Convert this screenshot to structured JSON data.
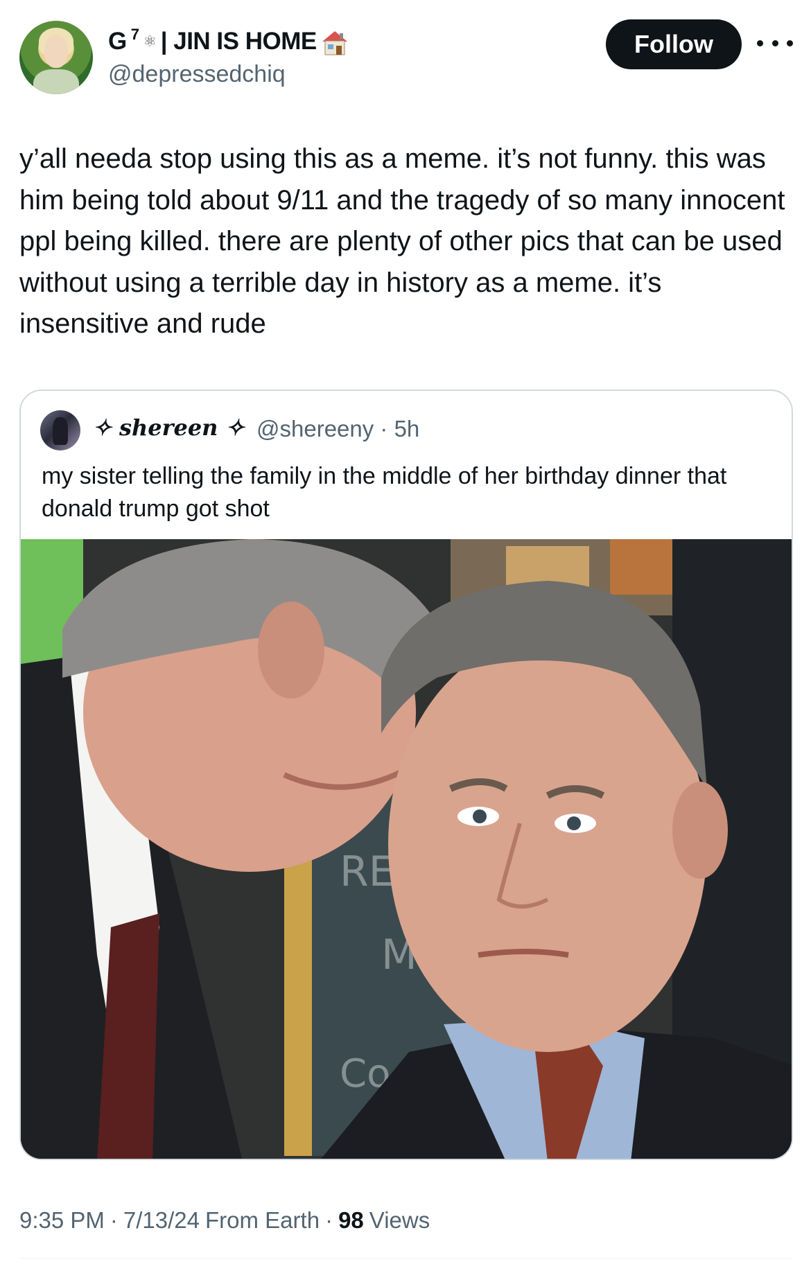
{
  "author": {
    "display_name": "G",
    "superscript": "7",
    "name_suffix": "| JIN IS HOME",
    "emoji_icon": "house-icon",
    "handle": "@depressedchiq"
  },
  "actions": {
    "follow_label": "Follow",
    "more_icon": "more-icon"
  },
  "tweet": {
    "text": "y’all needa stop using this as a meme. it’s not funny. this was him being told about 9/11 and the tragedy of so many innocent ppl being killed. there are plenty of other pics that can be used without using a terrible day in history as a meme. it’s insensitive and rude"
  },
  "quote": {
    "display_name": "✧ shereen ✧",
    "handle_time": "@shereeny · 5h",
    "text": "my sister telling the family in the middle of her birthday dinner that donald trump got shot",
    "image_text": [
      "RE",
      "M",
      "Co"
    ]
  },
  "meta": {
    "time": "9:35 PM",
    "date": "7/13/24",
    "source": "From Earth",
    "views_count": "98",
    "views_label": "Views"
  }
}
